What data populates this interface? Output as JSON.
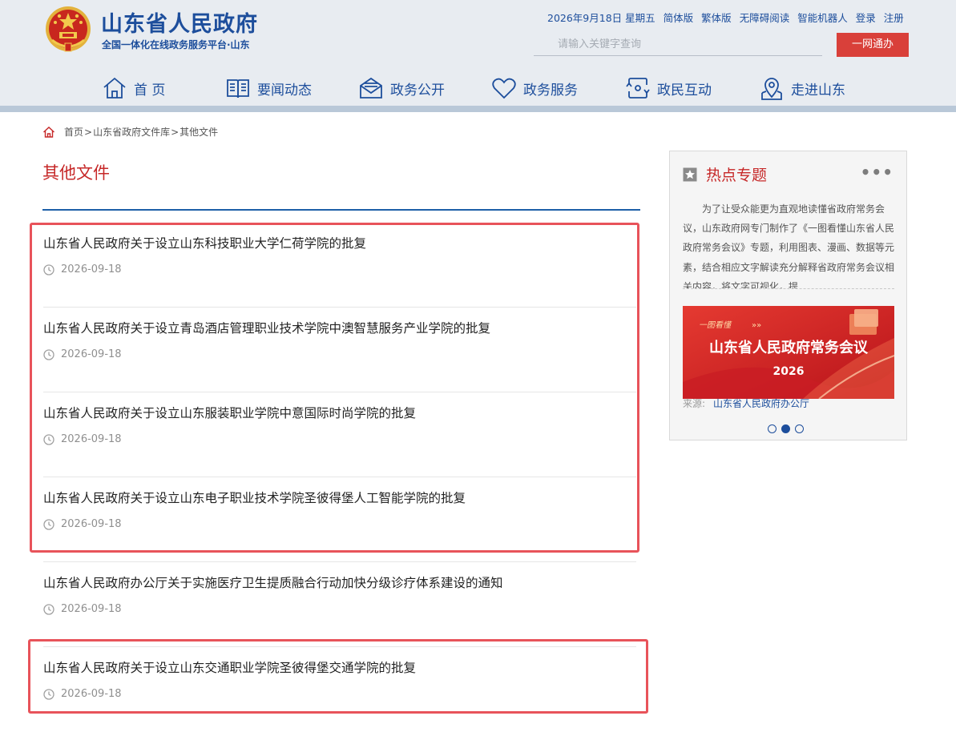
{
  "header": {
    "title": "山东省人民政府",
    "subtitle": "全国一体化在线政务服务平台·山东",
    "date": "2026年9月18日 星期五",
    "links": [
      "简体版",
      "繁体版",
      "无障碍阅读",
      "智能机器人",
      "登录",
      "注册"
    ],
    "search_placeholder": "请输入关键字查询",
    "login_button": "一网通办",
    "nav": [
      {
        "label": "首 页",
        "icon": "home-icon"
      },
      {
        "label": "要闻动态",
        "icon": "book-icon"
      },
      {
        "label": "政务公开",
        "icon": "mail-icon"
      },
      {
        "label": "政务服务",
        "icon": "heart-icon"
      },
      {
        "label": "政民互动",
        "icon": "interaction-icon"
      },
      {
        "label": "走进山东",
        "icon": "location-icon"
      }
    ],
    "colors": {
      "brand": "#1d4e9c",
      "accent": "#d9403a"
    }
  },
  "breadcrumb": {
    "items": [
      "首页",
      "山东省政府文件库"
    ],
    "separator": ">",
    "current": "其他文件"
  },
  "main": {
    "title": "其他文件",
    "items": [
      {
        "title": "山东省人民政府关于设立山东科技职业大学仁荷学院的批复",
        "date": "2026-09-18"
      },
      {
        "title": "山东省人民政府关于设立青岛酒店管理职业技术学院中澳智慧服务产业学院的批复",
        "date": "2026-09-18"
      },
      {
        "title": "山东省人民政府关于设立山东服装职业学院中意国际时尚学院的批复",
        "date": "2026-09-18"
      },
      {
        "title": "山东省人民政府关于设立山东电子职业技术学院圣彼得堡人工智能学院的批复",
        "date": "2026-09-18"
      },
      {
        "title": "山东省人民政府办公厅关于实施医疗卫生提质融合行动加快分级诊疗体系建设的通知",
        "date": "2026-09-18"
      },
      {
        "title": "山东省人民政府关于设立山东交通职业学院圣彼得堡交通学院的批复",
        "date": "2026-09-18"
      }
    ]
  },
  "sidebar": {
    "title": "热点专题",
    "more": "•••",
    "text": "为了让受众能更为直观地读懂省政府常务会议，山东政府网专门制作了《一图看懂山东省人民政府常务会议》专题，利用图表、漫画、数据等元素，结合相应文字解读充分解释省政府常务会议相关内容，将文字可视化，提",
    "banner": {
      "tag": "一图看懂",
      "title": "山东省人民政府常务会议",
      "year": "2026"
    },
    "source_label": "来源:",
    "source_value": "山东省人民政府办公厅",
    "carousel_active_index": 1,
    "carousel_count": 3
  }
}
